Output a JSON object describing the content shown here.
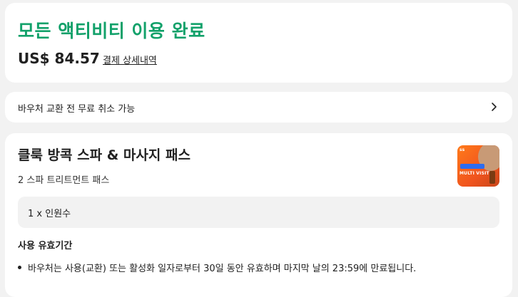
{
  "summary": {
    "title": "모든 액티비티 이용 완료",
    "price": "US$ 84.57",
    "payment_details_link": "결제 상세내역"
  },
  "cancellation": {
    "text": "바우처 교환 전 무료 취소 가능",
    "icon": "chevron-right-icon"
  },
  "product": {
    "title": "클룩 방콕 스파 & 마사지 패스",
    "subtitle": "2 스파 트리트먼트 패스",
    "thumbnail_tag": "ss",
    "thumbnail_text": "MULTI VISIT",
    "quantity": "1 x 인원수",
    "validity_heading": "사용 유효기간",
    "validity_items": [
      "바우처는 사용(교환) 또는 활성화 일자로부터 30일 동안 유효하며 마지막 날의 23:59에 만료됩니다."
    ]
  },
  "colors": {
    "accent_green": "#12a16a",
    "background": "#f2f2f2"
  }
}
